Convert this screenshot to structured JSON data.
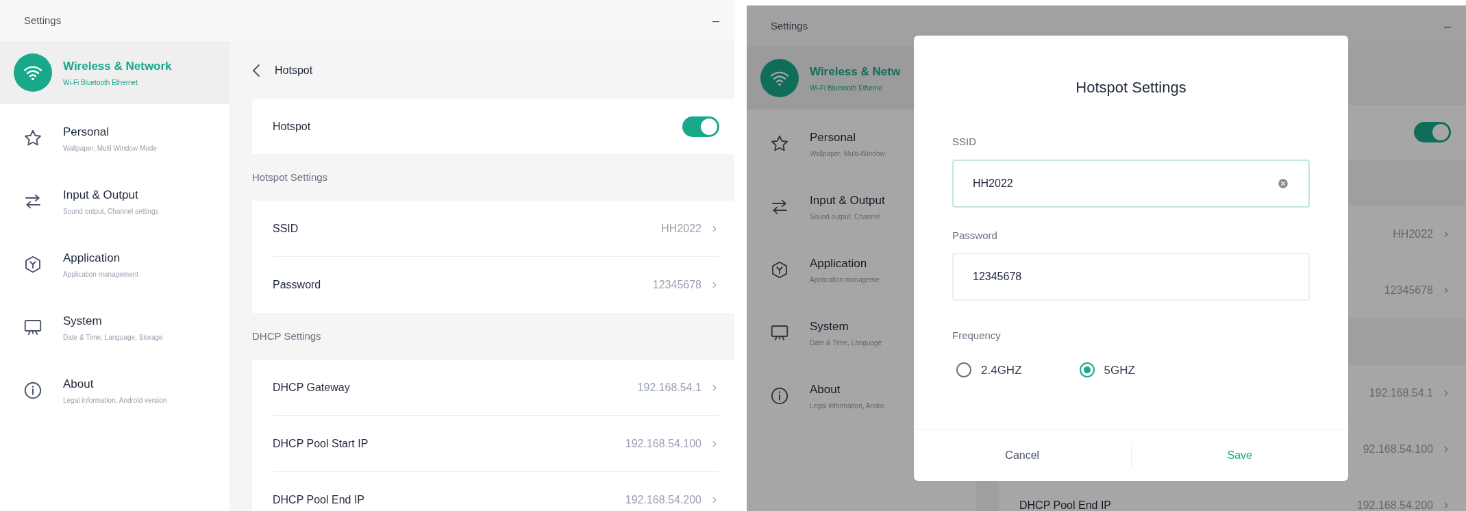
{
  "panels": [
    {
      "title": "Settings",
      "minimize": "–",
      "dimmed": false,
      "sidebar": [
        {
          "title": "Wireless & Network",
          "subtitle": "Wi-Fi Bluetooth Ethernet",
          "selected": true
        },
        {
          "title": "Personal",
          "subtitle": "Wallpaper, Multi Window Mode",
          "selected": false
        },
        {
          "title": "Input & Output",
          "subtitle": "Sound output, Channel settings",
          "selected": false
        },
        {
          "title": "Application",
          "subtitle": "Application management",
          "selected": false
        },
        {
          "title": "System",
          "subtitle": "Date & Time, Language, Storage",
          "selected": false
        },
        {
          "title": "About",
          "subtitle": "Legal information, Android version",
          "selected": false
        }
      ],
      "page": {
        "title": "Hotspot",
        "switch_row": {
          "label": "Hotspot",
          "on": true
        },
        "sections": [
          {
            "heading": "Hotspot Settings",
            "rows": [
              {
                "label": "SSID",
                "value": "HH2022"
              },
              {
                "label": "Password",
                "value": "12345678"
              }
            ]
          },
          {
            "heading": "DHCP Settings",
            "rows": [
              {
                "label": "DHCP Gateway",
                "value": "192.168.54.1"
              },
              {
                "label": "DHCP Pool Start IP",
                "value": "192.168.54.100"
              },
              {
                "label": "DHCP Pool End IP",
                "value": "192.168.54.200"
              }
            ]
          }
        ]
      }
    },
    {
      "title": "Settings",
      "minimize": "–",
      "dimmed": true,
      "sidebar": [
        {
          "title": "Wireless & Netw",
          "subtitle": "Wi-Fi Bluetooth Etherne",
          "selected": true
        },
        {
          "title": "Personal",
          "subtitle": "Wallpaper, Multi-Window",
          "selected": false
        },
        {
          "title": "Input & Output",
          "subtitle": "Sound output, Channel",
          "selected": false
        },
        {
          "title": "Application",
          "subtitle": "Application manageme",
          "selected": false
        },
        {
          "title": "System",
          "subtitle": "Date & Time, Language",
          "selected": false
        },
        {
          "title": "About",
          "subtitle": "Legal information, Andro",
          "selected": false
        }
      ],
      "page": {
        "switch_row": {
          "on": true
        },
        "sections": [
          {
            "rows": [
              {
                "value": "HH2022"
              },
              {
                "value": "12345678"
              }
            ]
          },
          {
            "rows": [
              {
                "value": "192.168.54.1"
              },
              {
                "value": "92.168.54.100"
              },
              {
                "label": "DHCP Pool End IP",
                "value": "192.168.54.200"
              }
            ]
          }
        ]
      },
      "dialog": {
        "title": "Hotspot Settings",
        "fields": [
          {
            "label": "SSID",
            "value": "HH2022",
            "focused": true,
            "clearable": true
          },
          {
            "label": "Password",
            "value": "12345678",
            "focused": false,
            "clearable": false
          }
        ],
        "frequency": {
          "label": "Frequency",
          "options": [
            {
              "label": "2.4GHZ",
              "selected": false
            },
            {
              "label": "5GHZ",
              "selected": true
            }
          ]
        },
        "buttons": [
          {
            "label": "Cancel",
            "kind": "secondary"
          },
          {
            "label": "Save",
            "kind": "primary"
          }
        ]
      }
    }
  ]
}
